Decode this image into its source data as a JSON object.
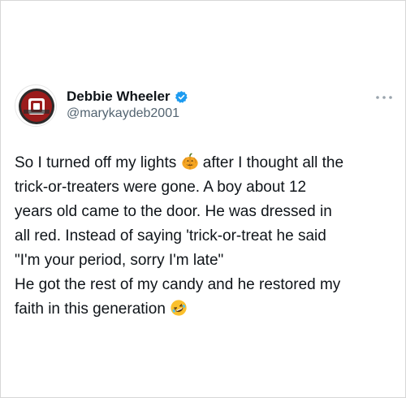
{
  "tweet": {
    "author": {
      "display_name": "Debbie Wheeler",
      "handle": "@marykaydeb2001",
      "verified": true,
      "avatar_icon": "oklahoma-sooners-logo-icon"
    },
    "more_icon": "more-options-icon",
    "lines": [
      {
        "before": "So I turned off my lights ",
        "emoji": "jack-o-lantern-icon",
        "after": " after I thought all the"
      },
      {
        "text": "trick-or-treaters were gone. A boy about 12"
      },
      {
        "text": "years old came to the door. He was dressed in"
      },
      {
        "text": "all red. Instead of saying 'trick-or-treat he said"
      },
      {
        "text": "\"I'm your period, sorry I'm late\""
      },
      {
        "text": "He got the rest of my candy and he restored my"
      },
      {
        "before": "faith in this generation ",
        "emoji": "rolling-on-floor-laughing-icon",
        "after": ""
      }
    ]
  },
  "colors": {
    "text": "#0f1419",
    "secondary": "#536471",
    "verified": "#1d9bf0",
    "avatar_red": "#8b1a1a",
    "emoji_orange": "#f5a623",
    "emoji_yellow": "#fbc02d"
  }
}
